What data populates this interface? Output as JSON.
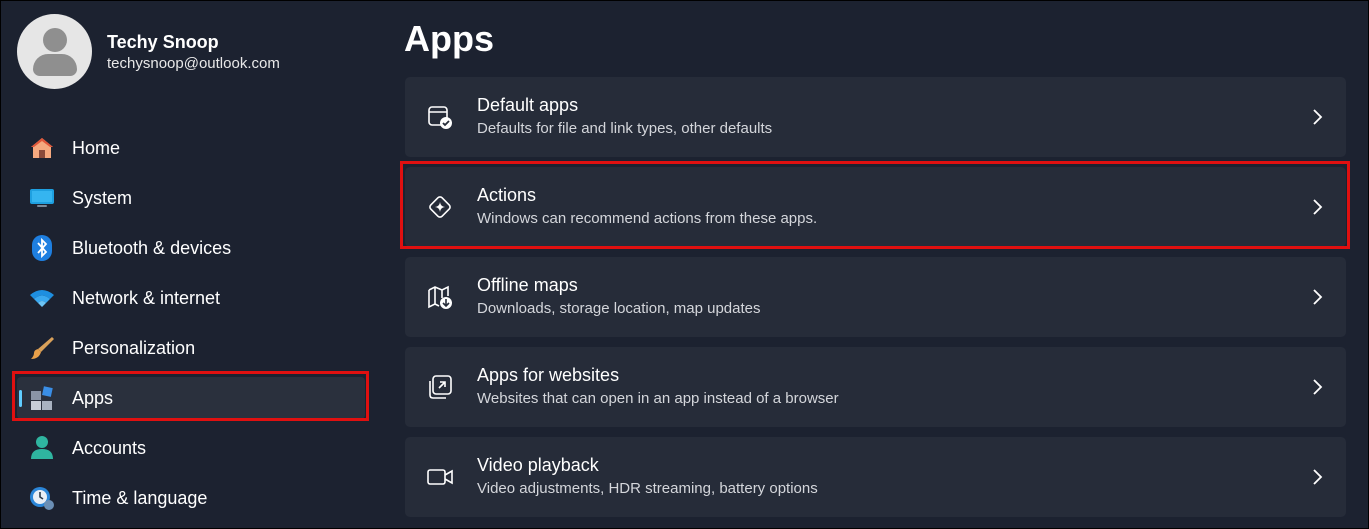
{
  "user": {
    "name": "Techy Snoop",
    "email": "techysnoop@outlook.com"
  },
  "sidebar": {
    "items": [
      {
        "label": "Home",
        "icon": "home-icon"
      },
      {
        "label": "System",
        "icon": "system-icon"
      },
      {
        "label": "Bluetooth & devices",
        "icon": "bluetooth-icon"
      },
      {
        "label": "Network & internet",
        "icon": "wifi-icon"
      },
      {
        "label": "Personalization",
        "icon": "brush-icon"
      },
      {
        "label": "Apps",
        "icon": "apps-icon",
        "selected": true
      },
      {
        "label": "Accounts",
        "icon": "accounts-icon"
      },
      {
        "label": "Time & language",
        "icon": "time-language-icon"
      }
    ]
  },
  "main": {
    "title": "Apps",
    "cards": [
      {
        "title": "Default apps",
        "subtitle": "Defaults for file and link types, other defaults",
        "icon": "default-apps-icon"
      },
      {
        "title": "Actions",
        "subtitle": "Windows can recommend actions from these apps.",
        "icon": "actions-icon"
      },
      {
        "title": "Offline maps",
        "subtitle": "Downloads, storage location, map updates",
        "icon": "offline-maps-icon"
      },
      {
        "title": "Apps for websites",
        "subtitle": "Websites that can open in an app instead of a browser",
        "icon": "apps-for-websites-icon"
      },
      {
        "title": "Video playback",
        "subtitle": "Video adjustments, HDR streaming, battery options",
        "icon": "video-playback-icon"
      }
    ]
  },
  "colors": {
    "background": "#1c2230",
    "card": "#262c39",
    "accent": "#60cdff",
    "highlight": "#e01010"
  }
}
